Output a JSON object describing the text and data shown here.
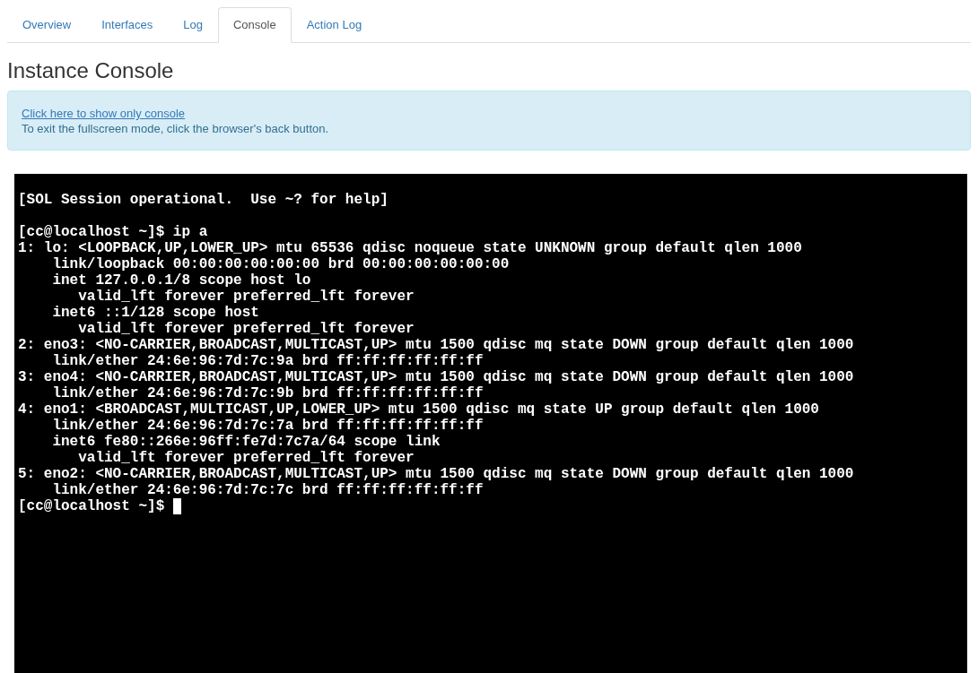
{
  "tabs": [
    {
      "label": "Overview",
      "selected": false
    },
    {
      "label": "Interfaces",
      "selected": false
    },
    {
      "label": "Log",
      "selected": false
    },
    {
      "label": "Console",
      "selected": true
    },
    {
      "label": "Action Log",
      "selected": false
    }
  ],
  "heading": "Instance Console",
  "alert": {
    "link": "Click here to show only console",
    "text": "To exit the fullscreen mode, click the browser's back button."
  },
  "console": {
    "blocks": [
      {
        "lines": [
          "[SOL Session operational.  Use ~? for help]"
        ]
      },
      {
        "lines": [
          "[cc@localhost ~]$ ip a",
          "1: lo: <LOOPBACK,UP,LOWER_UP> mtu 65536 qdisc noqueue state UNKNOWN group default qlen 1000",
          "    link/loopback 00:00:00:00:00:00 brd 00:00:00:00:00:00",
          "    inet 127.0.0.1/8 scope host lo",
          "       valid_lft forever preferred_lft forever",
          "    inet6 ::1/128 scope host",
          "       valid_lft forever preferred_lft forever",
          "2: eno3: <NO-CARRIER,BROADCAST,MULTICAST,UP> mtu 1500 qdisc mq state DOWN group default qlen 1000",
          "    link/ether 24:6e:96:7d:7c:9a brd ff:ff:ff:ff:ff:ff",
          "3: eno4: <NO-CARRIER,BROADCAST,MULTICAST,UP> mtu 1500 qdisc mq state DOWN group default qlen 1000",
          "    link/ether 24:6e:96:7d:7c:9b brd ff:ff:ff:ff:ff:ff",
          "4: eno1: <BROADCAST,MULTICAST,UP,LOWER_UP> mtu 1500 qdisc mq state UP group default qlen 1000",
          "    link/ether 24:6e:96:7d:7c:7a brd ff:ff:ff:ff:ff:ff",
          "    inet6 fe80::266e:96ff:fe7d:7c7a/64 scope link",
          "       valid_lft forever preferred_lft forever",
          "5: eno2: <NO-CARRIER,BROADCAST,MULTICAST,UP> mtu 1500 qdisc mq state DOWN group default qlen 1000",
          "    link/ether 24:6e:96:7d:7c:7c brd ff:ff:ff:ff:ff:ff",
          "[cc@localhost ~]$"
        ]
      }
    ]
  }
}
